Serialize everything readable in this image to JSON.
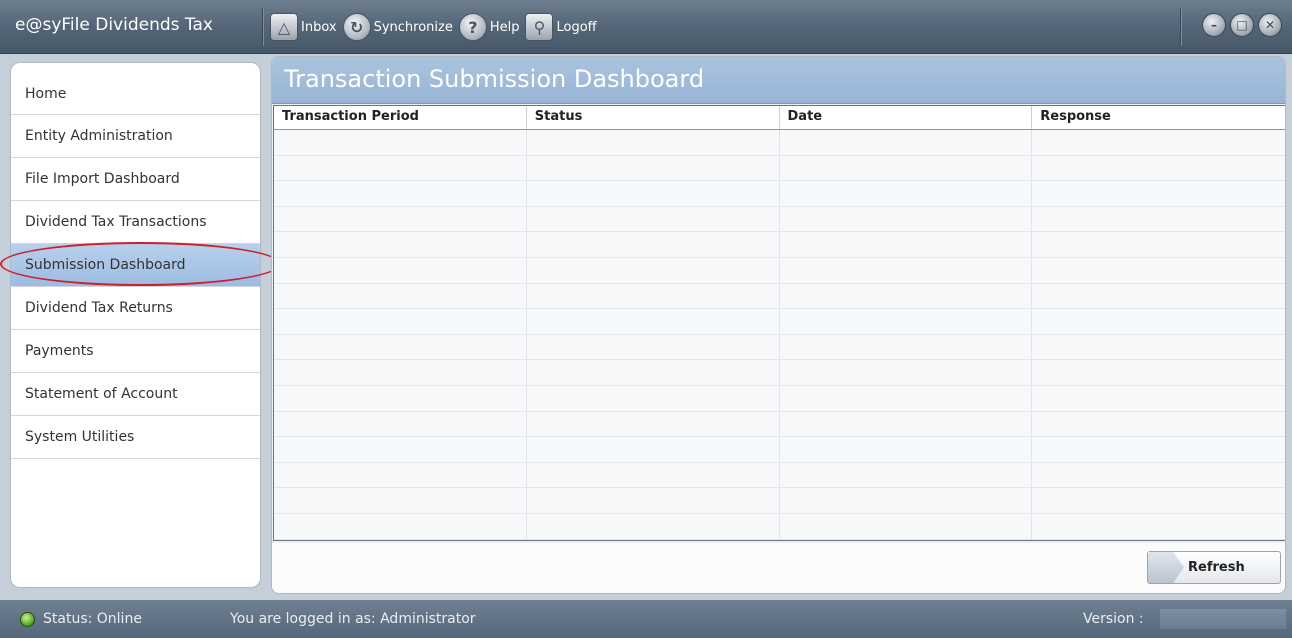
{
  "app": {
    "title": "e@syFile Dividends Tax"
  },
  "toolbar": {
    "items": [
      {
        "label": "Inbox",
        "icon": "inbox-icon"
      },
      {
        "label": "Synchronize",
        "icon": "sync-icon"
      },
      {
        "label": "Help",
        "icon": "help-icon"
      },
      {
        "label": "Logoff",
        "icon": "key-icon"
      }
    ]
  },
  "window_controls": [
    "minimize-icon",
    "maximize-icon",
    "close-icon"
  ],
  "sidebar": {
    "items": [
      {
        "label": "Home"
      },
      {
        "label": "Entity Administration"
      },
      {
        "label": "File Import Dashboard"
      },
      {
        "label": "Dividend Tax Transactions"
      },
      {
        "label": "Submission Dashboard",
        "active": true
      },
      {
        "label": "Dividend Tax Returns"
      },
      {
        "label": "Payments"
      },
      {
        "label": "Statement of Account"
      },
      {
        "label": "System Utilities"
      }
    ]
  },
  "main": {
    "title": "Transaction Submission Dashboard",
    "table": {
      "columns": [
        "Transaction Period",
        "Status",
        "Date",
        "Response"
      ],
      "rows": []
    },
    "refresh_label": "Refresh"
  },
  "status": {
    "text": "Status: Online",
    "logged_in": "You are logged in as: Administrator",
    "version_label": "Version :"
  },
  "colors": {
    "titlebar": "#546577",
    "header": "#a3bddb",
    "active_nav": "#a9c6e8",
    "highlight": "#cc1f2a",
    "status_online": "#4da21a"
  }
}
